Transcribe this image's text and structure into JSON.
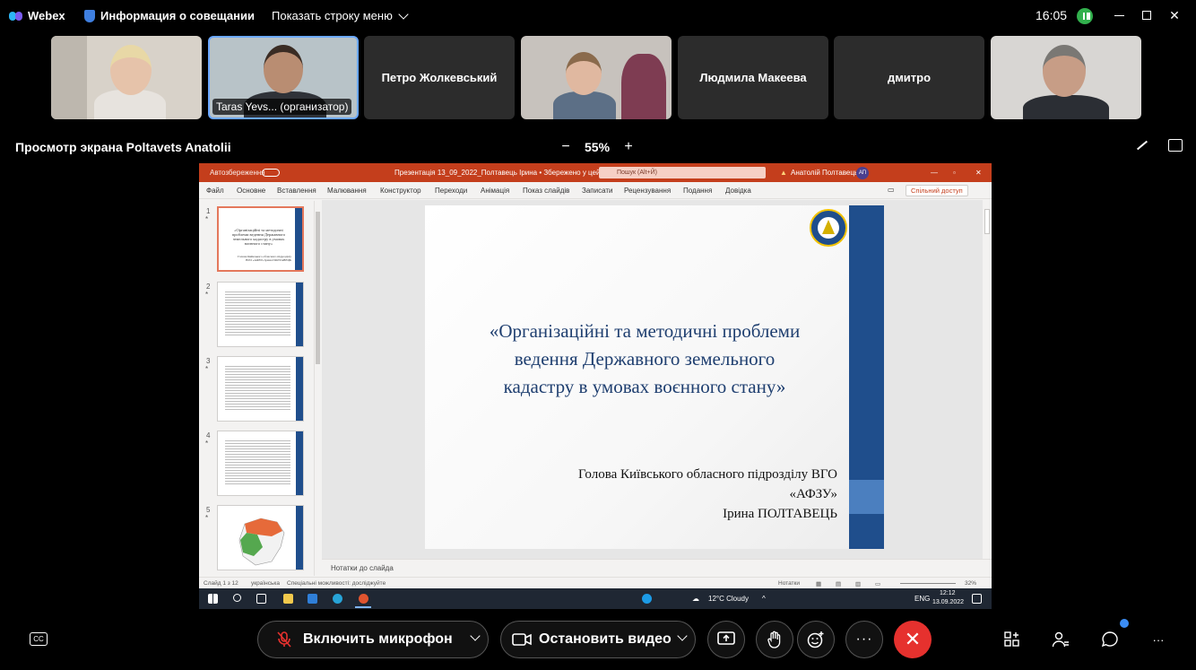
{
  "app": {
    "name": "Webex",
    "meeting_info": "Информация о совещании",
    "menu_toggle": "Показать строку меню",
    "time": "16:05",
    "colors": {
      "accent": "#6aa7ff",
      "end_call": "#e6312e",
      "ppt": "#c43e1c",
      "slide_blue": "#1f4e8c"
    }
  },
  "participants": [
    {
      "name": "",
      "type": "video"
    },
    {
      "name": "Taras Yevs... (организатор)",
      "type": "video",
      "active": true
    },
    {
      "name": "Петро Жолкевський",
      "type": "name"
    },
    {
      "name": "",
      "type": "video"
    },
    {
      "name": "Людмила Макеева",
      "type": "name"
    },
    {
      "name": "дмитро",
      "type": "name"
    },
    {
      "name": "",
      "type": "video"
    }
  ],
  "share": {
    "title": "Просмотр экрана Poltavets Anatolii",
    "zoom": "55%",
    "zoom_minus": "−",
    "zoom_plus": "+"
  },
  "ppt": {
    "autosave": "Автозбереження",
    "doc_title": "Презентація 13_09_2022_Полтавець Ірина • Збережено у цей ПК",
    "search_placeholder": "Пошук (Alt+Й)",
    "user": "Анатолій Полтавець",
    "user_initials": "АП",
    "menu": [
      "Файл",
      "Основне",
      "Вставлення",
      "Малювання",
      "Конструктор",
      "Переходи",
      "Анімація",
      "Показ слайдів",
      "Записати",
      "Рецензування",
      "Подання",
      "Довідка"
    ],
    "share_btn": "Спільний доступ",
    "thumbnails": [
      {
        "num": "1",
        "title": "«Організаційні та методичні проблеми ведення Державного земельного кадастру в умовах воєнного стану»",
        "sub": "Голова Київського обласного підрозділу ВГО «АФЗУ» Ірина ПОЛТАВЕЦЬ"
      },
      {
        "num": "2"
      },
      {
        "num": "3"
      },
      {
        "num": "4"
      },
      {
        "num": "5"
      }
    ],
    "slide": {
      "title_lines": [
        "«Організаційні та методичні проблеми",
        "ведення Державного земельного",
        "кадастру в умовах воєнного стану»"
      ],
      "author_lines": [
        "Голова Київського обласного підрозділу ВГО",
        "«АФЗУ»",
        "Ірина ПОЛТАВЕЦЬ"
      ]
    },
    "notes": "Нотатки до слайда",
    "status": {
      "slide": "Слайд 1 з 12",
      "lang": "українська",
      "accessibility": "Спеціальні можливості: досліджуйте",
      "notes_btn": "Нотатки",
      "zoom": "32%"
    },
    "taskbar": {
      "weather": "12°C Cloudy",
      "lang": "ENG",
      "time": "12:12",
      "date": "13.09.2022"
    }
  },
  "controls": {
    "mic": "Включить микрофон",
    "video": "Остановить видео"
  }
}
